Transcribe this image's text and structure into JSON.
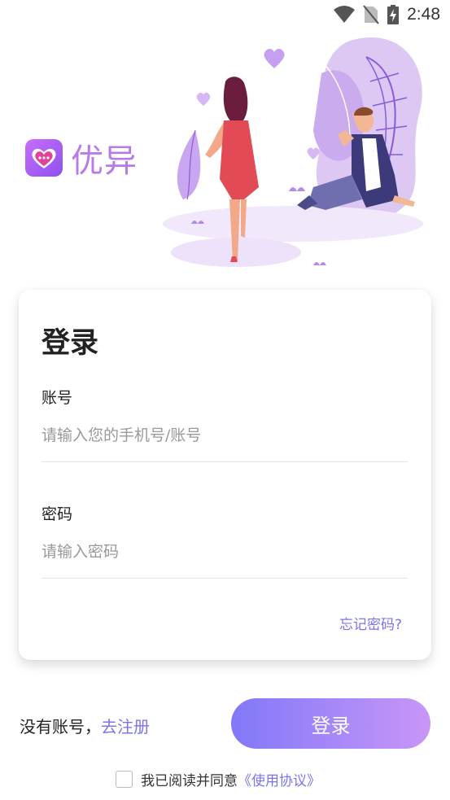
{
  "status_bar": {
    "time": "2:48",
    "icons": [
      "wifi-icon",
      "no-sim-icon",
      "battery-charging-icon"
    ]
  },
  "app": {
    "name": "优异",
    "logo_icon": "heart-chat-icon"
  },
  "login_card": {
    "title": "登录",
    "account_label": "账号",
    "account_placeholder": "请输入您的手机号/账号",
    "account_value": "",
    "password_label": "密码",
    "password_placeholder": "请输入密码",
    "password_value": "",
    "forgot_password": "忘记密码?"
  },
  "footer": {
    "no_account_text": "没有账号，",
    "register_link": "去注册",
    "login_button": "登录",
    "agree_text": "我已阅读并同意",
    "agreement_link": "《使用协议》",
    "agree_checked": false
  },
  "colors": {
    "accent": "#7c73f0",
    "logo_gradient_start": "#c86dfb",
    "logo_gradient_end": "#8c52ee",
    "button_gradient_start": "#8178f8",
    "button_gradient_end": "#c896f7"
  }
}
